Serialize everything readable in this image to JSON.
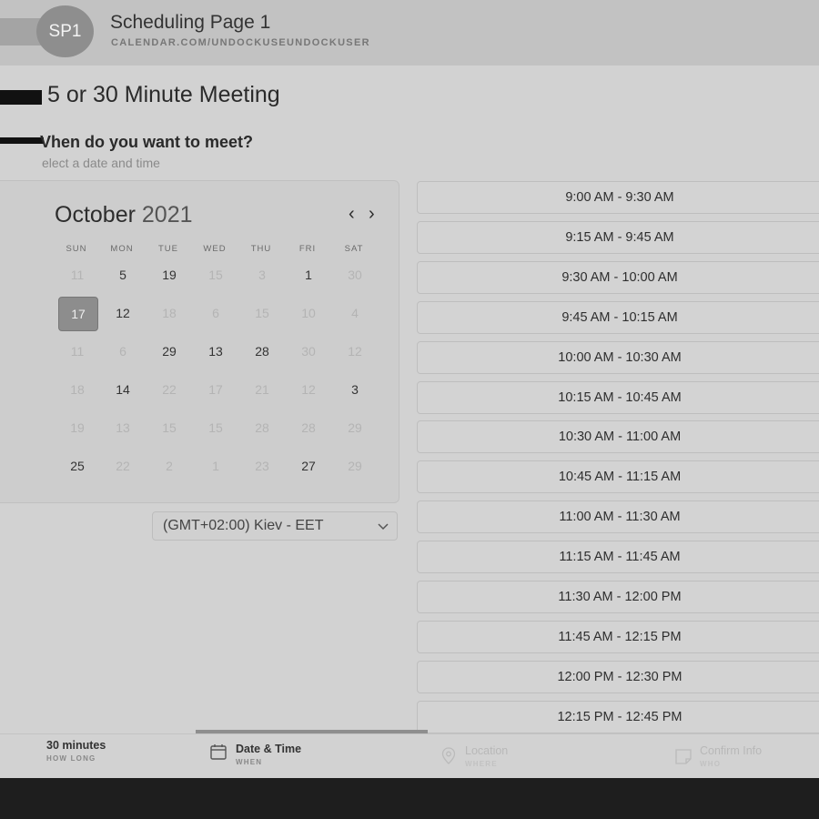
{
  "header": {
    "avatar_initials": "SP1",
    "title": "Scheduling Page 1",
    "url": "CALENDAR.COM/UNDOCKUSEUNDOCKUSER"
  },
  "meeting": {
    "title": "5 or 30 Minute Meeting",
    "question": "Vhen do you want to meet?",
    "subtitle": "elect a date and time"
  },
  "calendar": {
    "month": "October",
    "year": "2021",
    "prev_label": "‹",
    "next_label": "›",
    "weekdays": [
      "SUN",
      "MON",
      "TUE",
      "WED",
      "THU",
      "FRI",
      "SAT"
    ],
    "weeks": [
      [
        {
          "d": "11",
          "s": "dim"
        },
        {
          "d": "5",
          "s": "on"
        },
        {
          "d": "19",
          "s": "on"
        },
        {
          "d": "15",
          "s": "dim"
        },
        {
          "d": "3",
          "s": "dim"
        },
        {
          "d": "1",
          "s": "on"
        },
        {
          "d": "30",
          "s": "dim"
        }
      ],
      [
        {
          "d": "17",
          "s": "sel"
        },
        {
          "d": "12",
          "s": "on"
        },
        {
          "d": "18",
          "s": "dim"
        },
        {
          "d": "6",
          "s": "dim"
        },
        {
          "d": "15",
          "s": "dim"
        },
        {
          "d": "10",
          "s": "dim"
        },
        {
          "d": "4",
          "s": "dim"
        }
      ],
      [
        {
          "d": "11",
          "s": "dim"
        },
        {
          "d": "6",
          "s": "dim"
        },
        {
          "d": "29",
          "s": "on"
        },
        {
          "d": "13",
          "s": "on"
        },
        {
          "d": "28",
          "s": "on"
        },
        {
          "d": "30",
          "s": "dim"
        },
        {
          "d": "12",
          "s": "dim"
        }
      ],
      [
        {
          "d": "18",
          "s": "dim"
        },
        {
          "d": "14",
          "s": "on"
        },
        {
          "d": "22",
          "s": "dim"
        },
        {
          "d": "17",
          "s": "dim"
        },
        {
          "d": "21",
          "s": "dim"
        },
        {
          "d": "12",
          "s": "dim"
        },
        {
          "d": "3",
          "s": "on"
        }
      ],
      [
        {
          "d": "19",
          "s": "dim"
        },
        {
          "d": "13",
          "s": "dim"
        },
        {
          "d": "15",
          "s": "dim"
        },
        {
          "d": "15",
          "s": "dim"
        },
        {
          "d": "28",
          "s": "dim"
        },
        {
          "d": "28",
          "s": "dim"
        },
        {
          "d": "29",
          "s": "dim"
        }
      ],
      [
        {
          "d": "25",
          "s": "on"
        },
        {
          "d": "22",
          "s": "dim"
        },
        {
          "d": "2",
          "s": "dim"
        },
        {
          "d": "1",
          "s": "dim"
        },
        {
          "d": "23",
          "s": "dim"
        },
        {
          "d": "27",
          "s": "on"
        },
        {
          "d": "29",
          "s": "dim"
        }
      ]
    ]
  },
  "timezone": {
    "selected": "(GMT+02:00) Kiev - EET",
    "chevron_icon": "chevron-down-icon"
  },
  "time_slots": [
    "9:00 AM - 9:30 AM",
    "9:15 AM - 9:45 AM",
    "9:30 AM - 10:00 AM",
    "9:45 AM - 10:15 AM",
    "10:00 AM - 10:30 AM",
    "10:15 AM - 10:45 AM",
    "10:30 AM - 11:00 AM",
    "10:45 AM - 11:15 AM",
    "11:00 AM - 11:30 AM",
    "11:15 AM - 11:45 AM",
    "11:30 AM - 12:00 PM",
    "11:45 AM - 12:15 PM",
    "12:00 PM - 12:30 PM",
    "12:15 PM - 12:45 PM"
  ],
  "steps": {
    "duration": {
      "label": "30 minutes",
      "sub": "HOW LONG"
    },
    "datetime": {
      "label": "Date & Time",
      "sub": "WHEN",
      "icon": "calendar-icon"
    },
    "location": {
      "label": "Location",
      "sub": "WHERE",
      "icon": "location-pin-icon"
    },
    "confirm": {
      "label": "Confirm Info",
      "sub": "WHO",
      "icon": "note-icon"
    }
  },
  "colors": {
    "selected_day": "#8d8d8d",
    "header_bg": "#c2c2c2",
    "page_bg": "#d2d2d2"
  }
}
